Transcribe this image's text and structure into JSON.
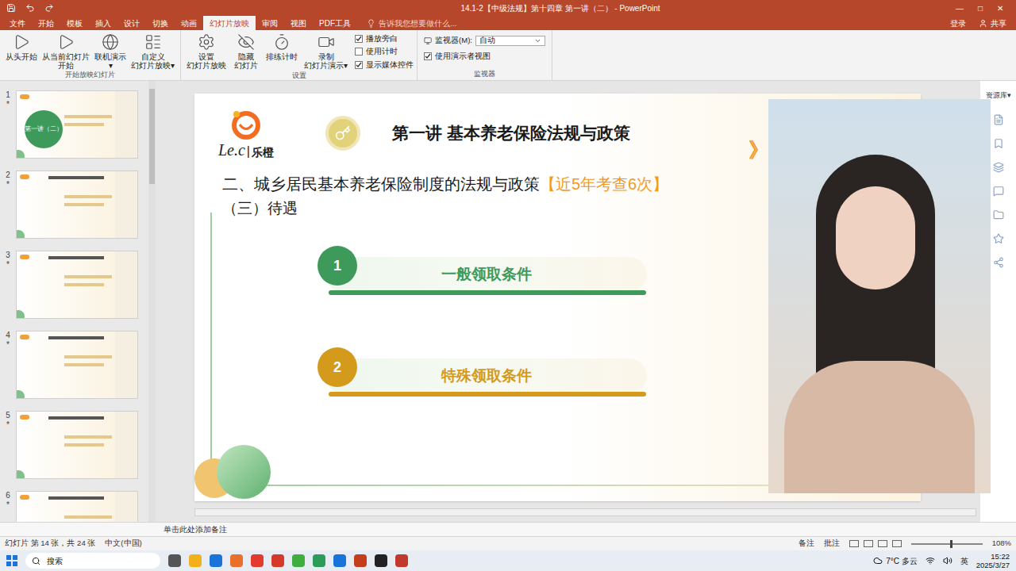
{
  "window": {
    "title": "14.1-2【中级法规】第十四章 第一讲（二） - PowerPoint",
    "controls": [
      "—",
      "□",
      "✕"
    ]
  },
  "tabs": [
    {
      "label": "文件",
      "selected": false
    },
    {
      "label": "开始",
      "selected": false
    },
    {
      "label": "模板",
      "selected": false
    },
    {
      "label": "插入",
      "selected": false
    },
    {
      "label": "设计",
      "selected": false
    },
    {
      "label": "切换",
      "selected": false
    },
    {
      "label": "动画",
      "selected": false
    },
    {
      "label": "幻灯片放映",
      "selected": true
    },
    {
      "label": "审阅",
      "selected": false
    },
    {
      "label": "视图",
      "selected": false
    },
    {
      "label": "PDF工具",
      "selected": false
    }
  ],
  "search": {
    "placeholder": "告诉我您想要做什么..."
  },
  "account": {
    "login": "登录",
    "share": "共享"
  },
  "ribbon": {
    "start_group": {
      "label": "开始放映幻灯片",
      "buttons": [
        {
          "lines": [
            "从头开始"
          ]
        },
        {
          "lines": [
            "从当前幻灯片",
            "开始"
          ]
        },
        {
          "lines": [
            "联机演示",
            "▾"
          ]
        },
        {
          "lines": [
            "自定义",
            "幻灯片放映▾"
          ]
        }
      ]
    },
    "setup_group": {
      "label": "设置",
      "buttons": [
        {
          "lines": [
            "设置",
            "幻灯片放映"
          ]
        },
        {
          "lines": [
            "隐藏",
            "幻灯片"
          ]
        },
        {
          "lines": [
            "排练计时"
          ]
        },
        {
          "lines": [
            "录制",
            "幻灯片演示▾"
          ]
        }
      ],
      "checkboxes": [
        {
          "label": "播放旁白",
          "checked": true
        },
        {
          "label": "使用计时",
          "checked": false
        },
        {
          "label": "显示媒体控件",
          "checked": true
        }
      ]
    },
    "monitor_group": {
      "label": "监视器",
      "monitor_label": "监视器(M):",
      "monitor_value": "自动",
      "presenter": {
        "label": "使用演示者视图",
        "checked": true
      }
    }
  },
  "thumbnails": [
    {
      "number": "1",
      "star": "*",
      "title": "第一讲（二）"
    },
    {
      "number": "2",
      "star": "*",
      "title": ""
    },
    {
      "number": "3",
      "star": "*",
      "title": ""
    },
    {
      "number": "4",
      "star": "*",
      "title": ""
    },
    {
      "number": "5",
      "star": "*",
      "title": ""
    },
    {
      "number": "6",
      "star": "*",
      "title": ""
    }
  ],
  "slide": {
    "logo": {
      "mark": "Le.c",
      "separator": "|",
      "brand": "乐橙"
    },
    "title": "第一讲 基本养老保险法规与政策",
    "heading": {
      "main": "二、城乡居民基本养老保险制度的法规与政策",
      "highlight": "【近5年考查6次】"
    },
    "subheading": "（三）待遇",
    "chevron": "》",
    "items": [
      {
        "number": "1",
        "label": "一般领取条件",
        "color": "#3e9a5a"
      },
      {
        "number": "2",
        "label": "特殊领取条件",
        "color": "#d39a1c"
      }
    ]
  },
  "side_panel": {
    "label": "资源库▾"
  },
  "notes": {
    "placeholder": "单击此处添加备注"
  },
  "status_bar": {
    "slide": "幻灯片 第 14 张，共 24 张",
    "language": "中文(中国)",
    "notes": "备注",
    "comments": "批注",
    "zoom": "108%",
    "zoom_level": 0.55
  },
  "taskbar": {
    "search": "搜索",
    "weather": "7°C 多云",
    "ime": "英",
    "time": "15:22",
    "date": "2025/3/27"
  }
}
